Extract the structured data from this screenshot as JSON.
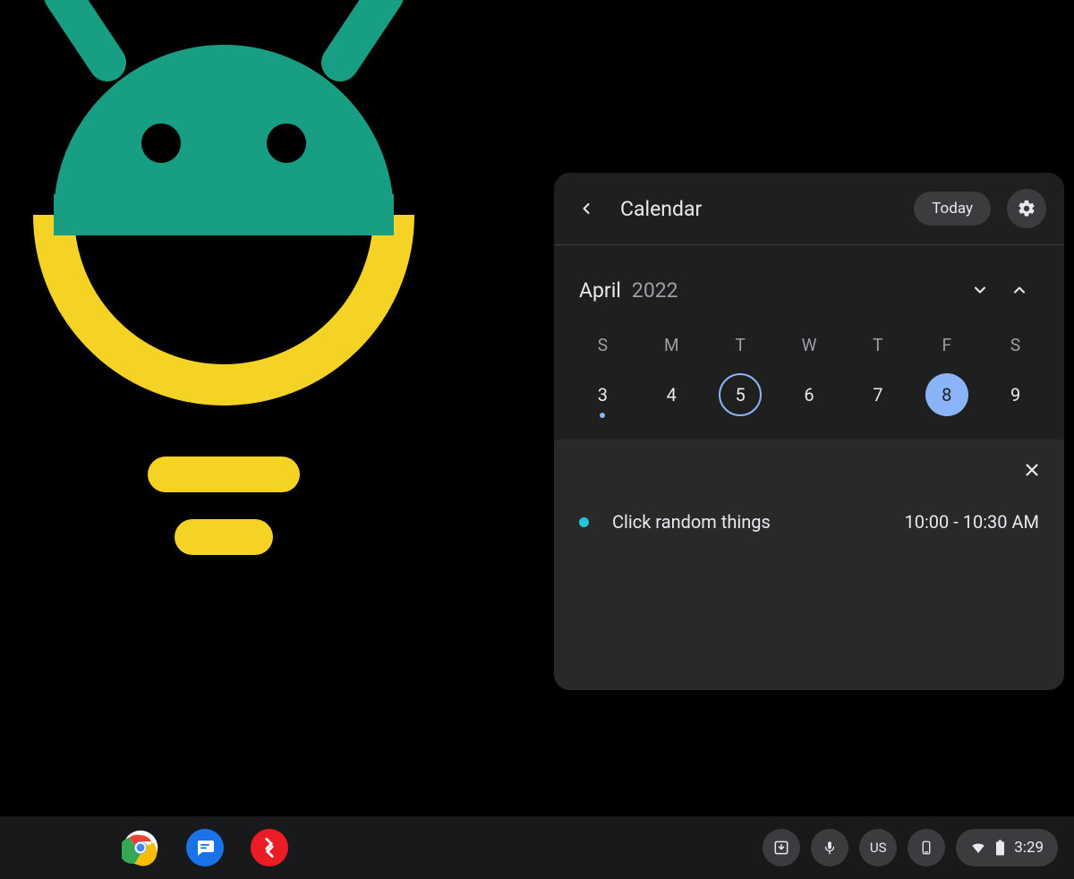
{
  "calendar": {
    "title": "Calendar",
    "today_label": "Today",
    "month": "April",
    "year": "2022",
    "weekdays": [
      "S",
      "M",
      "T",
      "W",
      "T",
      "F",
      "S"
    ],
    "days": [
      {
        "num": "3",
        "today": false,
        "selected": false,
        "has_event": true
      },
      {
        "num": "4",
        "today": false,
        "selected": false,
        "has_event": false
      },
      {
        "num": "5",
        "today": true,
        "selected": false,
        "has_event": false
      },
      {
        "num": "6",
        "today": false,
        "selected": false,
        "has_event": false
      },
      {
        "num": "7",
        "today": false,
        "selected": false,
        "has_event": false
      },
      {
        "num": "8",
        "today": false,
        "selected": true,
        "has_event": false
      },
      {
        "num": "9",
        "today": false,
        "selected": false,
        "has_event": false
      }
    ],
    "event": {
      "title": "Click random things",
      "time": "10:00 - 10:30 AM",
      "color": "#26c6da"
    }
  },
  "shelf": {
    "keyboard_layout": "US",
    "clock": "3:29"
  }
}
